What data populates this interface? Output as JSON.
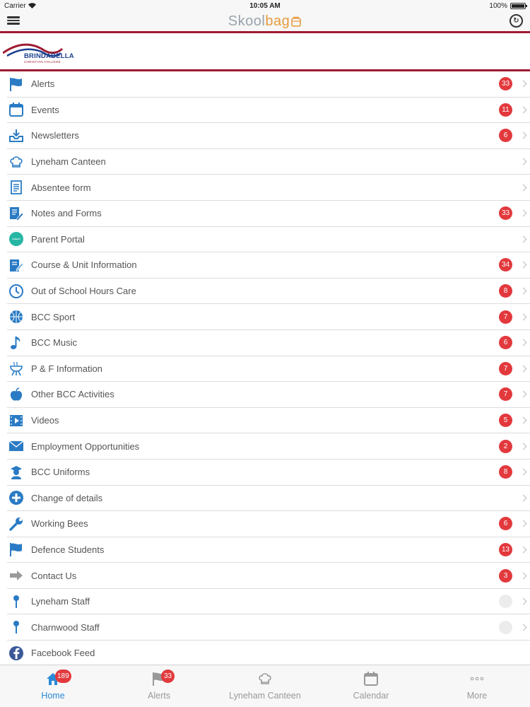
{
  "status": {
    "carrier": "Carrier",
    "time": "10:05 AM",
    "battery": "100%"
  },
  "app": {
    "logo_main": "Skool",
    "logo_accent": "bag"
  },
  "school": {
    "name": "BRINDABELLA",
    "sub": "CHRISTIAN COLLEGE"
  },
  "menu": [
    {
      "label": "Alerts",
      "badge": "33",
      "icon": "flag-icon"
    },
    {
      "label": "Events",
      "badge": "11",
      "icon": "calendar-icon"
    },
    {
      "label": "Newsletters",
      "badge": "6",
      "icon": "inbox-download-icon"
    },
    {
      "label": "Lyneham Canteen",
      "badge": "",
      "icon": "chef-hat-icon"
    },
    {
      "label": "Absentee form",
      "badge": "",
      "icon": "document-icon"
    },
    {
      "label": "Notes and Forms",
      "badge": "33",
      "icon": "notes-pencil-icon"
    },
    {
      "label": "Parent Portal",
      "badge": "",
      "icon": "portal-icon"
    },
    {
      "label": "Course & Unit Information",
      "badge": "34",
      "icon": "edit-document-icon"
    },
    {
      "label": "Out of School Hours Care",
      "badge": "8",
      "icon": "clock-icon"
    },
    {
      "label": "BCC Sport",
      "badge": "7",
      "icon": "basketball-icon"
    },
    {
      "label": "BCC Music",
      "badge": "6",
      "icon": "music-note-icon"
    },
    {
      "label": "P & F Information",
      "badge": "7",
      "icon": "bbq-icon"
    },
    {
      "label": "Other BCC Activities",
      "badge": "7",
      "icon": "apple-icon"
    },
    {
      "label": "Videos",
      "badge": "5",
      "icon": "video-icon"
    },
    {
      "label": "Employment Opportunities",
      "badge": "2",
      "icon": "envelope-icon"
    },
    {
      "label": "BCC Uniforms",
      "badge": "8",
      "icon": "student-icon"
    },
    {
      "label": "Change of details",
      "badge": "",
      "icon": "plus-circle-icon"
    },
    {
      "label": "Working Bees",
      "badge": "6",
      "icon": "wrench-icon"
    },
    {
      "label": "Defence Students",
      "badge": "13",
      "icon": "flag-icon"
    },
    {
      "label": "Contact Us",
      "badge": "3",
      "icon": "arrow-right-icon"
    },
    {
      "label": "Lyneham Staff",
      "badge": "",
      "icon": "pin-icon"
    },
    {
      "label": "Charnwood Staff",
      "badge": "",
      "icon": "pin-icon"
    },
    {
      "label": "Facebook Feed",
      "badge": "",
      "icon": "facebook-icon"
    }
  ],
  "tabs": [
    {
      "label": "Home",
      "badge": "189",
      "icon": "home-icon",
      "active": true
    },
    {
      "label": "Alerts",
      "badge": "33",
      "icon": "flag-icon",
      "active": false
    },
    {
      "label": "Lyneham Canteen",
      "badge": "",
      "icon": "chef-hat-icon",
      "active": false
    },
    {
      "label": "Calendar",
      "badge": "",
      "icon": "calendar-icon",
      "active": false
    },
    {
      "label": "More",
      "badge": "",
      "icon": "more-dots-icon",
      "active": false
    }
  ],
  "colors": {
    "accent": "#2a7bc4",
    "badge": "#e2393d",
    "school_red": "#9e1b32",
    "school_blue": "#1d3f8f"
  }
}
